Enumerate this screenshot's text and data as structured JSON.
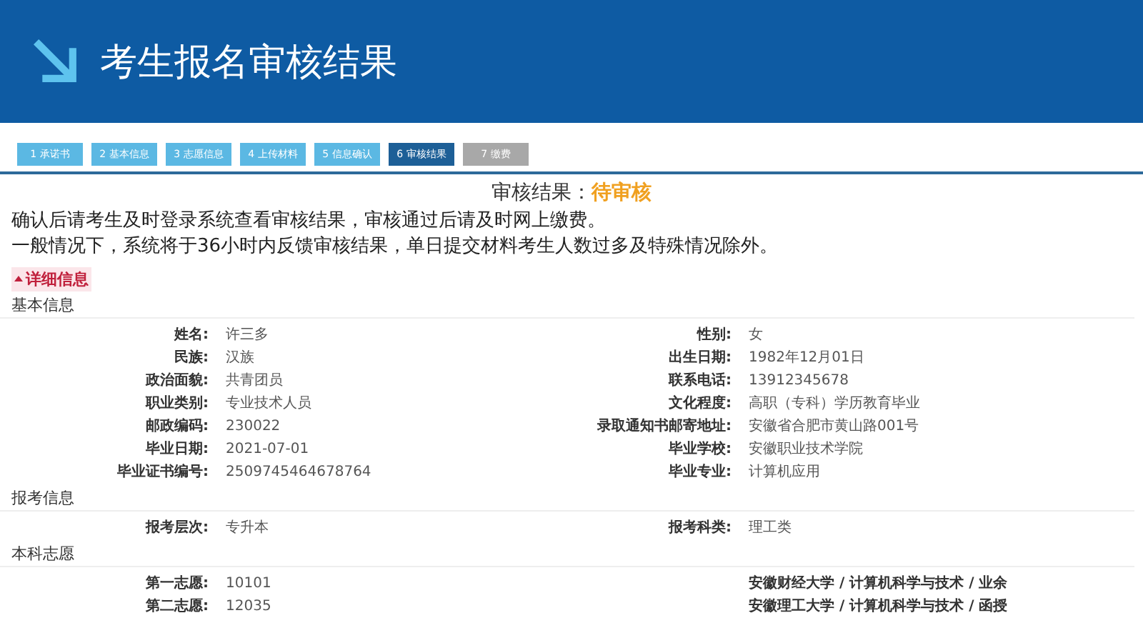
{
  "header": {
    "title": "考生报名审核结果"
  },
  "steps": [
    {
      "label": "1 承诺书",
      "kind": "done",
      "selected": false
    },
    {
      "label": "2 基本信息",
      "kind": "done",
      "selected": false
    },
    {
      "label": "3 志愿信息",
      "kind": "done",
      "selected": false
    },
    {
      "label": "4 上传材料",
      "kind": "done",
      "selected": false
    },
    {
      "label": "5 信息确认",
      "kind": "done",
      "selected": false
    },
    {
      "label": "6 审核结果",
      "kind": "done",
      "selected": true
    },
    {
      "label": "7 缴费",
      "kind": "pending",
      "selected": false
    }
  ],
  "result": {
    "label": "审核结果：",
    "status": "待审核"
  },
  "notices": [
    "确认后请考生及时登录系统查看审核结果，审核通过后请及时网上缴费。",
    "一般情况下，系统将于36小时内反馈审核结果，单日提交材料考生人数过多及特殊情况除外。"
  ],
  "details_toggle": {
    "label": "详细信息",
    "expanded": true
  },
  "sections": [
    {
      "title": "基本信息",
      "fields": [
        {
          "label": "姓名:",
          "value": "许三多"
        },
        {
          "label": "性别:",
          "value": "女"
        },
        {
          "label": "民族:",
          "value": "汉族"
        },
        {
          "label": "出生日期:",
          "value": "1982年12月01日"
        },
        {
          "label": "政治面貌:",
          "value": "共青团员"
        },
        {
          "label": "联系电话:",
          "value": "13912345678"
        },
        {
          "label": "职业类别:",
          "value": "专业技术人员"
        },
        {
          "label": "文化程度:",
          "value": "高职（专科）学历教育毕业"
        },
        {
          "label": "邮政编码:",
          "value": "230022"
        },
        {
          "label": "录取通知书邮寄地址:",
          "value": "安徽省合肥市黄山路001号"
        },
        {
          "label": "毕业日期:",
          "value": "2021-07-01"
        },
        {
          "label": "毕业学校:",
          "value": "安徽职业技术学院"
        },
        {
          "label": "毕业证书编号:",
          "value": "2509745464678764"
        },
        {
          "label": "毕业专业:",
          "value": "计算机应用"
        }
      ]
    },
    {
      "title": "报考信息",
      "fields": [
        {
          "label": "报考层次:",
          "value": "专升本"
        },
        {
          "label": "报考科类:",
          "value": "理工类"
        }
      ]
    },
    {
      "title": "本科志愿",
      "choices": [
        {
          "label": "第一志愿:",
          "code": "10101",
          "program": "安徽财经大学 / 计算机科学与技术 / 业余"
        },
        {
          "label": "第二志愿:",
          "code": "12035",
          "program": "安徽理工大学 / 计算机科学与技术 / 函授"
        }
      ]
    }
  ]
}
